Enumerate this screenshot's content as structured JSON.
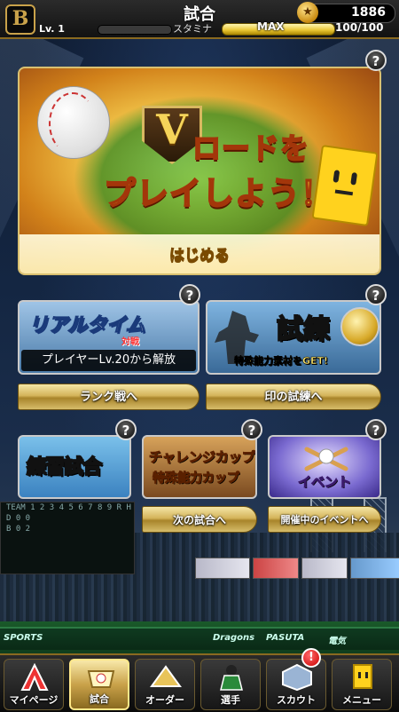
{
  "header": {
    "title": "試合",
    "team_logo": "B",
    "level_label": "Lv. 1",
    "stamina_label": "スタミナ",
    "stamina_max": "MAX",
    "stamina_value": "100/100",
    "coins": "1886",
    "coin_icon": "coin-icon"
  },
  "help_label": "?",
  "vroad": {
    "line1": "ロードを",
    "v_letter": "V",
    "line2": "プレイしよう！",
    "start_label": "はじめる"
  },
  "realtime": {
    "title": "リアルタイム",
    "subtitle": "対戦",
    "locked_text": "プレイヤーLv.20から解放"
  },
  "trial": {
    "title": "試練",
    "subtitle": "特殊能力素材をGET!"
  },
  "buttons": {
    "rank": "ランク戦へ",
    "trial": "印の試練へ",
    "next_match": "次の試合へ",
    "events_open": "開催中のイベントへ"
  },
  "practice": {
    "title": "練習試合"
  },
  "challenge": {
    "line1": "チャレンジカップ",
    "line2": "特殊能力カップ"
  },
  "event": {
    "title": "イベント"
  },
  "scoreboard": {
    "row1": "TEAM 1 2 3 4 5 6 7 8 9 R H",
    "row2": "D   0 0",
    "row3": "B   0 2"
  },
  "wall_ads": [
    "SPORTS",
    "Dragons",
    "PASUTA",
    "電気"
  ],
  "nav": [
    {
      "label": "マイページ",
      "icon": "mypage-icon"
    },
    {
      "label": "試合",
      "icon": "match-icon",
      "active": true
    },
    {
      "label": "オーダー",
      "icon": "order-icon"
    },
    {
      "label": "選手",
      "icon": "player-icon"
    },
    {
      "label": "スカウト",
      "icon": "scout-icon"
    },
    {
      "label": "メニュー",
      "icon": "menu-icon"
    }
  ],
  "alert_badge": "!",
  "colors": {
    "gold": "#c9a24a",
    "accent_yellow": "#ffe93a",
    "alert_red": "#cc0000"
  }
}
